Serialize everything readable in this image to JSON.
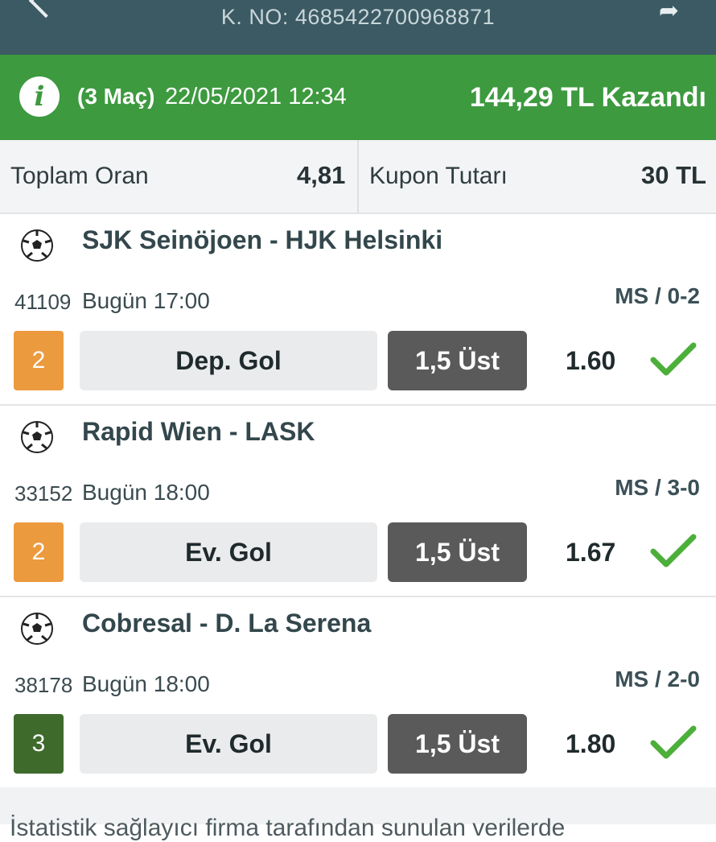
{
  "header": {
    "coupon_no": "K. NO: 4685422700968871",
    "back_icon": "chevron-left-icon",
    "share_icon": "share-icon"
  },
  "banner": {
    "match_count": "(3 Maç)",
    "date": "22/05/2021 12:34",
    "result": "144,29 TL Kazandı",
    "icon": "info-icon"
  },
  "summary": {
    "total_odds_label": "Toplam Oran",
    "total_odds_value": "4,81",
    "coupon_amount_label": "Kupon Tutarı",
    "coupon_amount_value": "30 TL"
  },
  "matches": [
    {
      "teams": "SJK Seinöjoen - HJK Helsinki",
      "code": "41109",
      "time": "Bugün 17:00",
      "score": "MS / 0-2",
      "mbs": "2",
      "mbs_color": "#ec9a3e",
      "bet_type": "Dep. Gol",
      "bet_choice": "1,5 Üst",
      "odd": "1.60"
    },
    {
      "teams": "Rapid Wien - LASK",
      "code": "33152",
      "time": "Bugün 18:00",
      "score": "MS / 3-0",
      "mbs": "2",
      "mbs_color": "#ec9a3e",
      "bet_type": "Ev. Gol",
      "bet_choice": "1,5 Üst",
      "odd": "1.67"
    },
    {
      "teams": "Cobresal - D. La Serena",
      "code": "38178",
      "time": "Bugün 18:00",
      "score": "MS / 2-0",
      "mbs": "3",
      "mbs_color": "#3e6a2c",
      "bet_type": "Ev. Gol",
      "bet_choice": "1,5 Üst",
      "odd": "1.80"
    }
  ],
  "colors": {
    "header_bg": "#3b5a63",
    "win_green": "#3d9a3f",
    "check_green": "#4caf3a"
  },
  "footer": {
    "note": "İstatistik sağlayıcı firma tarafından sunulan verilerde"
  }
}
